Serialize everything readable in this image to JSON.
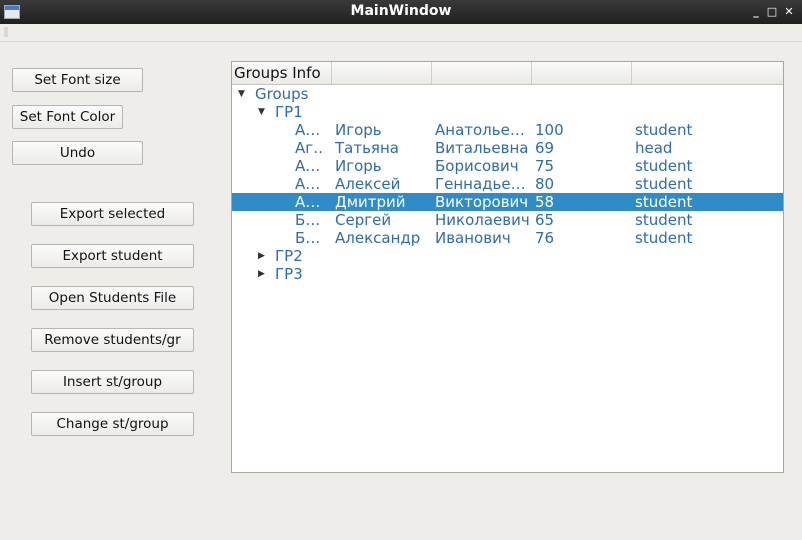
{
  "window": {
    "title": "MainWindow",
    "minimize": "_",
    "maximize": "□",
    "close": "✕"
  },
  "buttons": {
    "set_font_size": "Set Font size",
    "set_font_color": "Set Font Color",
    "undo": "Undo",
    "export_selected": "Export selected",
    "export_student": "Export student",
    "open_students_file": "Open Students File",
    "remove": "Remove students/gr",
    "insert": "Insert st/group",
    "change": "Change st/group"
  },
  "tree": {
    "header": [
      "Groups Info",
      "",
      "",
      "",
      ""
    ],
    "root": {
      "label": "Groups",
      "expanded": true
    },
    "groups": [
      {
        "label": "ГР1",
        "expanded": true,
        "students": [
          {
            "c0": "А…",
            "c1": "Игорь",
            "c2": "Анатолье…",
            "c3": "100",
            "c4": "student"
          },
          {
            "c0": "Аг…",
            "c1": "Татьяна",
            "c2": "Витальевна",
            "c3": "69",
            "c4": "head"
          },
          {
            "c0": "А…",
            "c1": "Игорь",
            "c2": "Борисович",
            "c3": "75",
            "c4": "student"
          },
          {
            "c0": "А…",
            "c1": "Алексей",
            "c2": "Геннадье…",
            "c3": "80",
            "c4": "student"
          },
          {
            "c0": "А…",
            "c1": "Дмитрий",
            "c2": "Викторович",
            "c3": "58",
            "c4": "student",
            "selected": true
          },
          {
            "c0": "Б…",
            "c1": "Сергей",
            "c2": "Николаевич",
            "c3": "65",
            "c4": "student"
          },
          {
            "c0": "Б…",
            "c1": "Александр",
            "c2": "Иванович",
            "c3": "76",
            "c4": "student"
          }
        ]
      },
      {
        "label": "ГР2",
        "expanded": false,
        "students": []
      },
      {
        "label": "ГР3",
        "expanded": false,
        "students": []
      }
    ]
  },
  "colors": {
    "selection": "#308cc6",
    "tree_text": "#2e6bb0"
  }
}
